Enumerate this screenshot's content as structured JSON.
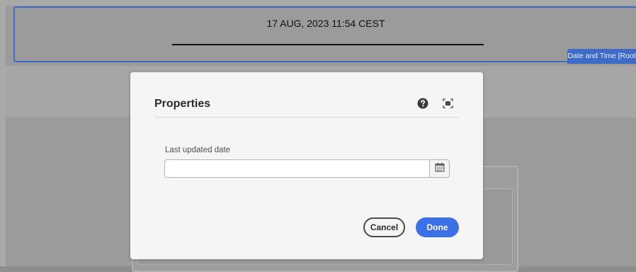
{
  "background": {
    "root_component": {
      "date_text": "17 AUG, 2023 11:54 CEST",
      "badge_label": "Date and Time [Root]"
    }
  },
  "dialog": {
    "title": "Properties",
    "icons": [
      "help-icon",
      "fullscreen-icon",
      "calendar-icon"
    ],
    "field": {
      "label": "Last updated date",
      "value": "",
      "placeholder": ""
    },
    "buttons": {
      "cancel_label": "Cancel",
      "done_label": "Done"
    }
  },
  "colors": {
    "accent": "#3b70e6",
    "selection_border": "#3e6bc7",
    "dialog_bg": "#f5f5f5",
    "overlay_bg": "#8e8e8e"
  }
}
